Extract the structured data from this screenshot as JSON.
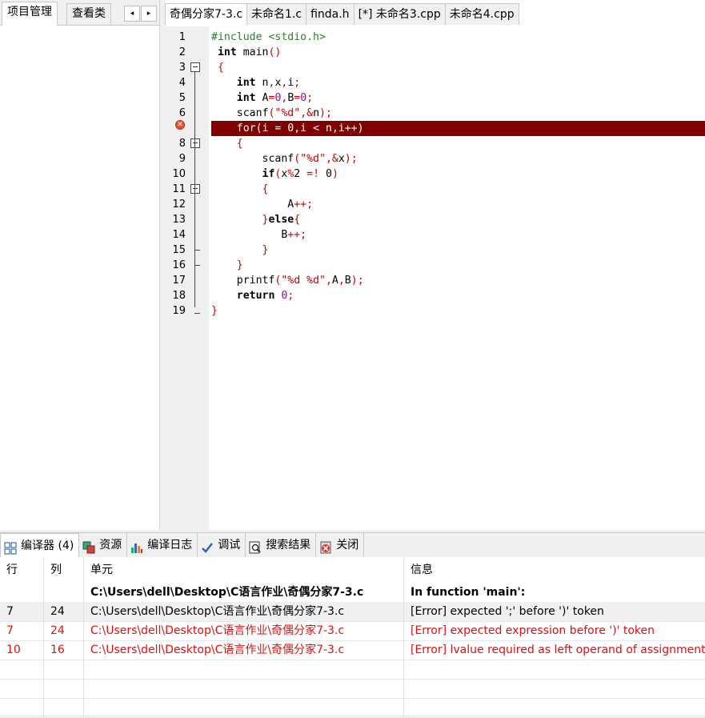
{
  "left_panel": {
    "tabs": [
      "项目管理",
      "查看类"
    ],
    "scroll_left": "◂",
    "scroll_right": "▸"
  },
  "file_tabs": [
    "奇偶分家7-3.c",
    "未命名1.c",
    "finda.h",
    "[*] 未命名3.cpp",
    "未命名4.cpp"
  ],
  "editor": {
    "line_numbers": [
      "1",
      "2",
      "3",
      "4",
      "5",
      "6",
      "7",
      "8",
      "9",
      "10",
      "11",
      "12",
      "13",
      "14",
      "15",
      "16",
      "17",
      "18",
      "19"
    ],
    "error_line": 7,
    "lines": [
      [
        {
          "t": "#include <stdio.h>",
          "c": "pp"
        }
      ],
      [
        {
          "t": " "
        },
        {
          "t": "int",
          "c": "kw"
        },
        {
          "t": " main"
        },
        {
          "t": "()",
          "c": "sym"
        }
      ],
      [
        {
          "t": " "
        },
        {
          "t": "{",
          "c": "sym"
        }
      ],
      [
        {
          "t": "    "
        },
        {
          "t": "int",
          "c": "kw"
        },
        {
          "t": " n"
        },
        {
          "t": ",",
          "c": "sym"
        },
        {
          "t": "x"
        },
        {
          "t": ",",
          "c": "sym"
        },
        {
          "t": "i"
        },
        {
          "t": ";",
          "c": "sym"
        }
      ],
      [
        {
          "t": "    "
        },
        {
          "t": "int",
          "c": "kw"
        },
        {
          "t": " A"
        },
        {
          "t": "=",
          "c": "sym"
        },
        {
          "t": "0",
          "c": "num"
        },
        {
          "t": ",",
          "c": "sym"
        },
        {
          "t": "B"
        },
        {
          "t": "=",
          "c": "sym"
        },
        {
          "t": "0",
          "c": "num"
        },
        {
          "t": ";",
          "c": "sym"
        }
      ],
      [
        {
          "t": "    scanf"
        },
        {
          "t": "(",
          "c": "sym"
        },
        {
          "t": "\"%d\"",
          "c": "str"
        },
        {
          "t": ",&",
          "c": "sym"
        },
        {
          "t": "n"
        },
        {
          "t": ");",
          "c": "sym"
        }
      ],
      [
        {
          "t": "    for(i = 0,i < n,i++)"
        }
      ],
      [
        {
          "t": "    "
        },
        {
          "t": "{",
          "c": "sym"
        }
      ],
      [
        {
          "t": "        scanf"
        },
        {
          "t": "(",
          "c": "sym"
        },
        {
          "t": "\"%d\"",
          "c": "str"
        },
        {
          "t": ",&",
          "c": "sym"
        },
        {
          "t": "x"
        },
        {
          "t": ");",
          "c": "sym"
        }
      ],
      [
        {
          "t": "        "
        },
        {
          "t": "if",
          "c": "kw"
        },
        {
          "t": "(",
          "c": "sym"
        },
        {
          "t": "x"
        },
        {
          "t": "%",
          "c": "sym"
        },
        {
          "t": "2 "
        },
        {
          "t": "=!",
          "c": "sym"
        },
        {
          "t": " 0"
        },
        {
          "t": ")",
          "c": "sym"
        }
      ],
      [
        {
          "t": "        "
        },
        {
          "t": "{",
          "c": "sym"
        }
      ],
      [
        {
          "t": "            A"
        },
        {
          "t": "++;",
          "c": "sym"
        }
      ],
      [
        {
          "t": "        "
        },
        {
          "t": "}",
          "c": "sym"
        },
        {
          "t": "else",
          "c": "kw"
        },
        {
          "t": "{",
          "c": "sym"
        }
      ],
      [
        {
          "t": "           B"
        },
        {
          "t": "++;",
          "c": "sym"
        }
      ],
      [
        {
          "t": "        "
        },
        {
          "t": "}",
          "c": "sym"
        }
      ],
      [
        {
          "t": "    "
        },
        {
          "t": "}",
          "c": "sym"
        }
      ],
      [
        {
          "t": "    printf"
        },
        {
          "t": "(",
          "c": "sym"
        },
        {
          "t": "\"%d %d\"",
          "c": "str"
        },
        {
          "t": ",",
          "c": "sym"
        },
        {
          "t": "A"
        },
        {
          "t": ",",
          "c": "sym"
        },
        {
          "t": "B"
        },
        {
          "t": ");",
          "c": "sym"
        }
      ],
      [
        {
          "t": "    "
        },
        {
          "t": "return",
          "c": "kw"
        },
        {
          "t": " "
        },
        {
          "t": "0",
          "c": "num"
        },
        {
          "t": ";",
          "c": "sym"
        }
      ],
      [
        {
          "t": "}",
          "c": "sym"
        }
      ]
    ]
  },
  "bottom_tabs": [
    {
      "label": "编译器 (4)",
      "icon": "grid-icon"
    },
    {
      "label": "资源",
      "icon": "resources-icon"
    },
    {
      "label": "编译日志",
      "icon": "chart-icon"
    },
    {
      "label": "调试",
      "icon": "check-icon"
    },
    {
      "label": "搜索结果",
      "icon": "search-icon"
    },
    {
      "label": "关闭",
      "icon": "close-icon"
    }
  ],
  "messages": {
    "headers": [
      "行",
      "列",
      "单元",
      "信息"
    ],
    "rows": [
      {
        "line": "",
        "col": "",
        "unit": "C:\\Users\\dell\\Desktop\\C语言作业\\奇偶分家7-3.c",
        "info": "In function 'main':",
        "style": "bold"
      },
      {
        "line": "7",
        "col": "24",
        "unit": "C:\\Users\\dell\\Desktop\\C语言作业\\奇偶分家7-3.c",
        "info": "[Error] expected ';' before ')' token",
        "style": "alt"
      },
      {
        "line": "7",
        "col": "24",
        "unit": "C:\\Users\\dell\\Desktop\\C语言作业\\奇偶分家7-3.c",
        "info": "[Error] expected expression before ')' token",
        "style": "err"
      },
      {
        "line": "10",
        "col": "16",
        "unit": "C:\\Users\\dell\\Desktop\\C语言作业\\奇偶分家7-3.c",
        "info": "[Error] lvalue required as left operand of assignment",
        "style": "err"
      }
    ]
  }
}
